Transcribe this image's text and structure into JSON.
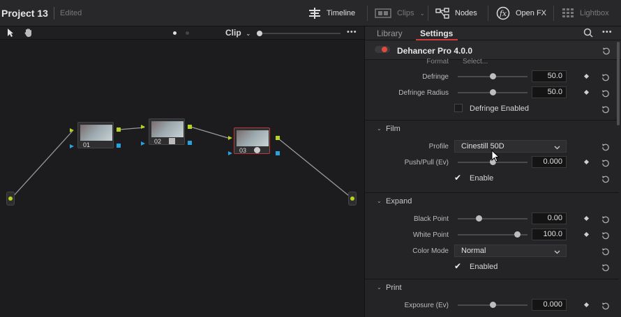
{
  "project": {
    "title": "Project 13",
    "status": "Edited"
  },
  "topbar": {
    "timeline_label": "Timeline",
    "clips_label": "Clips",
    "nodes_label": "Nodes",
    "openfx_label": "Open FX",
    "lightbox_label": "Lightbox"
  },
  "node_editor": {
    "mode_label": "Clip",
    "nodes": [
      {
        "label": "01"
      },
      {
        "label": "02"
      },
      {
        "label": "03"
      }
    ]
  },
  "panel": {
    "tabs": {
      "library": "Library",
      "settings": "Settings"
    },
    "plugin_name": "Dehancer Pro 4.0.0",
    "partial_row": {
      "label": "Format",
      "value": "Select..."
    },
    "defringe": {
      "label": "Defringe",
      "value": "50.0",
      "level": 0.5
    },
    "defringe_radius": {
      "label": "Defringe Radius",
      "value": "50.0",
      "level": 0.5
    },
    "defringe_enabled": {
      "label": "Defringe Enabled",
      "checked": false
    },
    "film": {
      "title": "Film",
      "profile_label": "Profile",
      "profile_value": "Cinestill 50D",
      "pushpull_label": "Push/Pull (Ev)",
      "pushpull_value": "0.000",
      "pushpull_level": 0.5,
      "enable_label": "Enable",
      "enable_checked": true
    },
    "expand": {
      "title": "Expand",
      "black_label": "Black Point",
      "black_value": "0.00",
      "black_level": 0.3,
      "white_label": "White Point",
      "white_value": "100.0",
      "white_level": 0.85,
      "colormode_label": "Color Mode",
      "colormode_value": "Normal",
      "enabled_label": "Enabled",
      "enabled_checked": true
    },
    "print": {
      "title": "Print",
      "exposure_label": "Exposure (Ev)",
      "exposure_value": "0.000",
      "exposure_level": 0.5
    }
  },
  "colors": {
    "accent_red": "#d03b3b",
    "port_green": "#b8d21e",
    "port_blue": "#27a2e0"
  }
}
